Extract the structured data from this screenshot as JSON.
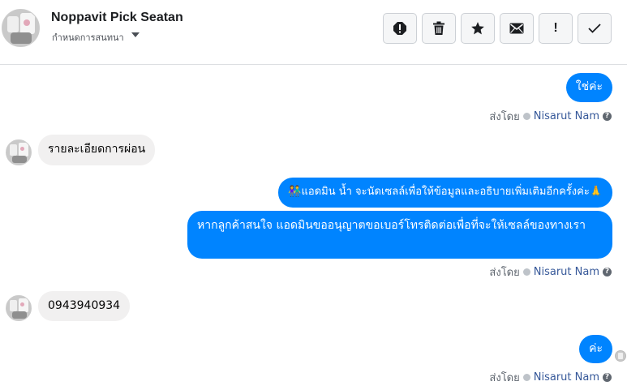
{
  "header": {
    "contact_name": "Noppavit Pick Seatan",
    "subtitle": "กำหนดการสนทนา"
  },
  "toolbar": {
    "icons": [
      "alert-circle-icon",
      "trash-icon",
      "star-icon",
      "envelope-icon",
      "exclamation-icon",
      "checkmark-icon"
    ],
    "exclamation_glyph": "!"
  },
  "messages": [
    {
      "direction": "out",
      "text": "ใช่ค่ะ"
    },
    {
      "direction": "in",
      "text": "รายละเอียดการผ่อน"
    },
    {
      "direction": "out",
      "text": "👫แอดมิน น้ำ จะนัดเซลล์เพื่อให้ข้อมูลและอธิบายเพิ่มเติมอีกครั้งค่ะ🙏"
    },
    {
      "direction": "out",
      "text": "หากลูกค้าสนใจ แอดมินขออนุญาตขอเบอร์โทรติดต่อเพื่อที่จะให้เซลล์ของทางเรา"
    },
    {
      "direction": "in",
      "text": "0943940934"
    },
    {
      "direction": "out",
      "text": "ค่ะ"
    }
  ],
  "sent_by": {
    "prefix": "ส่งโดย",
    "agent": "Nisarut Nam",
    "help": "?"
  },
  "colors": {
    "outgoing_bubble": "#0084ff",
    "incoming_bubble": "#f1f0f0",
    "link": "#365899"
  }
}
